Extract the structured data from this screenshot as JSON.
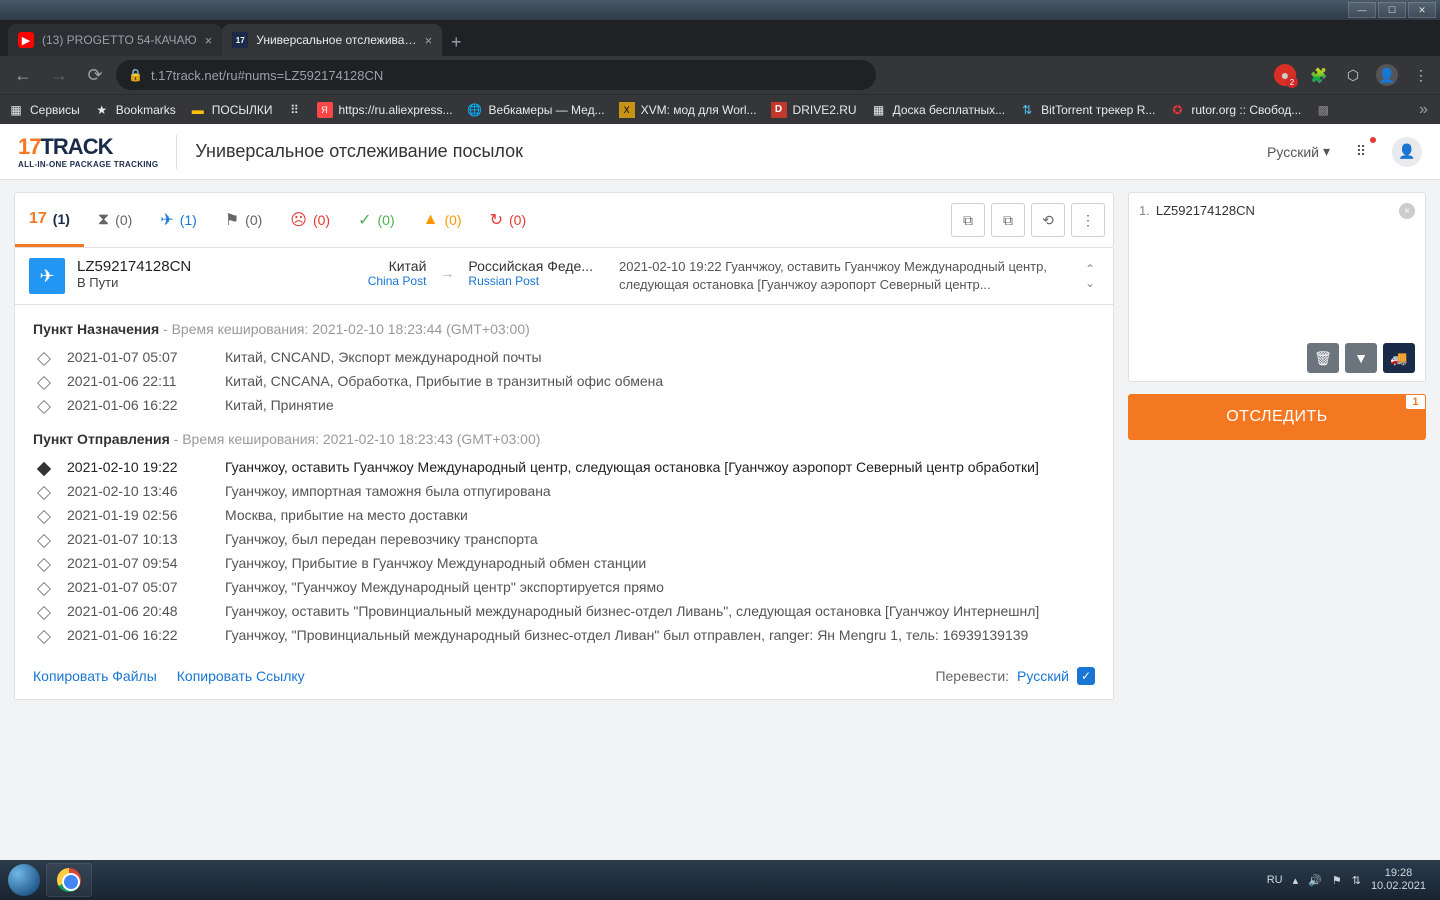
{
  "win": {
    "badge2": "2"
  },
  "tabs": [
    {
      "title": "(13) PROGETTO 54-КАЧАЮ",
      "fav": "▶"
    },
    {
      "title": "Универсальное отслеживание",
      "fav": "17"
    }
  ],
  "url": "t.17track.net/ru#nums=LZ592174128CN",
  "bookmarks": {
    "services": "Сервисы",
    "b1": "Bookmarks",
    "b2": "ПОСЫЛКИ",
    "b3": "https://ru.aliexpress...",
    "b4": "Вебкамеры — Мед...",
    "b5": "XVM: мод для Worl...",
    "b6": "DRIVE2.RU",
    "b7": "Доска бесплатных...",
    "b8": "BitTorrent трекер R...",
    "b9": "rutor.org :: Свобод..."
  },
  "header": {
    "title": "Универсальное отслеживание посылок",
    "logo_sub": "ALL-IN-ONE PACKAGE TRACKING",
    "lang": "Русский"
  },
  "filters": {
    "all": "(1)",
    "wait": "(0)",
    "transit": "(1)",
    "flag": "(0)",
    "sad": "(0)",
    "check": "(0)",
    "warn": "(0)",
    "clock": "(0)"
  },
  "pkg": {
    "num": "LZ592174128CN",
    "status": "В Пути",
    "from_country": "Китай",
    "from_carrier": "China Post",
    "to_country": "Российская Феде...",
    "to_carrier": "Russian Post",
    "latest": "2021-02-10 19:22  Гуанчжоу, оставить Гуанчжоу Международный центр, следующая остановка [Гуанчжоу аэропорт Северный центр..."
  },
  "dest": {
    "label": "Пункт Назначения",
    "meta": " - Время кеширования: 2021-02-10 18:23:44 (GMT+03:00)",
    "events": [
      {
        "ts": "2021-01-07 05:07",
        "desc": "Китай, CNCAND, Экспорт международной почты"
      },
      {
        "ts": "2021-01-06 22:11",
        "desc": "Китай, CNCANA, Обработка, Прибытие в транзитный офис обмена"
      },
      {
        "ts": "2021-01-06 16:22",
        "desc": "Китай, Принятие"
      }
    ]
  },
  "orig": {
    "label": "Пункт Отправления",
    "meta": " - Время кеширования: 2021-02-10 18:23:43 (GMT+03:00)",
    "events": [
      {
        "ts": "2021-02-10 19:22",
        "desc": "Гуанчжоу, оставить Гуанчжоу Международный центр, следующая остановка [Гуанчжоу аэропорт Северный центр обработки]",
        "current": true
      },
      {
        "ts": "2021-02-10 13:46",
        "desc": "Гуанчжоу, импортная таможня была отпугирована"
      },
      {
        "ts": "2021-01-19 02:56",
        "desc": "Москва, прибытие на место доставки"
      },
      {
        "ts": "2021-01-07 10:13",
        "desc": "Гуанчжоу, был передан перевозчику транспорта"
      },
      {
        "ts": "2021-01-07 09:54",
        "desc": "Гуанчжоу, Прибытие в Гуанчжоу Международный обмен станции"
      },
      {
        "ts": "2021-01-07 05:07",
        "desc": "Гуанчжоу, \"Гуанчжоу Международный центр\" экспортируется прямо"
      },
      {
        "ts": "2021-01-06 20:48",
        "desc": "Гуанчжоу, оставить \"Провинциальный международный бизнес-отдел Ливань\", следующая остановка [Гуанчжоу Интернешнл]"
      },
      {
        "ts": "2021-01-06 16:22",
        "desc": "Гуанчжоу, \"Провинциальный международный бизнес-отдел Ливан\" был отправлен, ranger: Ян Mengru 1, тель: 16939139139"
      }
    ]
  },
  "footer": {
    "copy_files": "Копировать Файлы",
    "copy_link": "Копировать Ссылку",
    "translate": "Перевести:",
    "lang": "Русский"
  },
  "side": {
    "line_no": "1.",
    "tracking": "LZ592174128CN",
    "track_btn": "ОТСЛЕДИТЬ",
    "badge": "1"
  },
  "tray": {
    "lang": "RU",
    "time": "19:28",
    "date": "10.02.2021"
  }
}
